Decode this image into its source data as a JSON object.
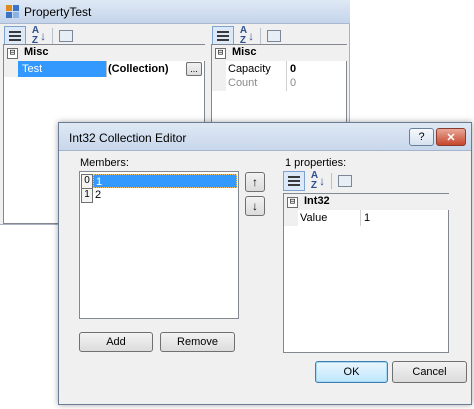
{
  "back_window": {
    "title": "PropertyTest",
    "left_grid": {
      "category": "Misc",
      "expander": "⊟",
      "row": {
        "name": "Test",
        "value": "(Collection)",
        "ellipsis": "..."
      }
    },
    "right_grid": {
      "category": "Misc",
      "expander": "⊟",
      "rows": [
        {
          "name": "Capacity",
          "value": "0"
        },
        {
          "name": "Count",
          "value": "0"
        }
      ]
    }
  },
  "dialog": {
    "title": "Int32 Collection Editor",
    "help_label": "?",
    "close_label": "✕",
    "members_label": "Members:",
    "members": [
      {
        "index": "0",
        "value": "1",
        "selected": true
      },
      {
        "index": "1",
        "value": "2",
        "selected": false
      }
    ],
    "move_up_label": "↑",
    "move_down_label": "↓",
    "add_label": "Add",
    "remove_label": "Remove",
    "properties_label": "1 properties:",
    "property_grid": {
      "category": "Int32",
      "expander": "⊟",
      "rows": [
        {
          "name": "Value",
          "value": "1"
        }
      ]
    },
    "ok_label": "OK",
    "cancel_label": "Cancel"
  },
  "colors": {
    "selection": "#3399ff",
    "accent_border": "#3c7fb1"
  }
}
